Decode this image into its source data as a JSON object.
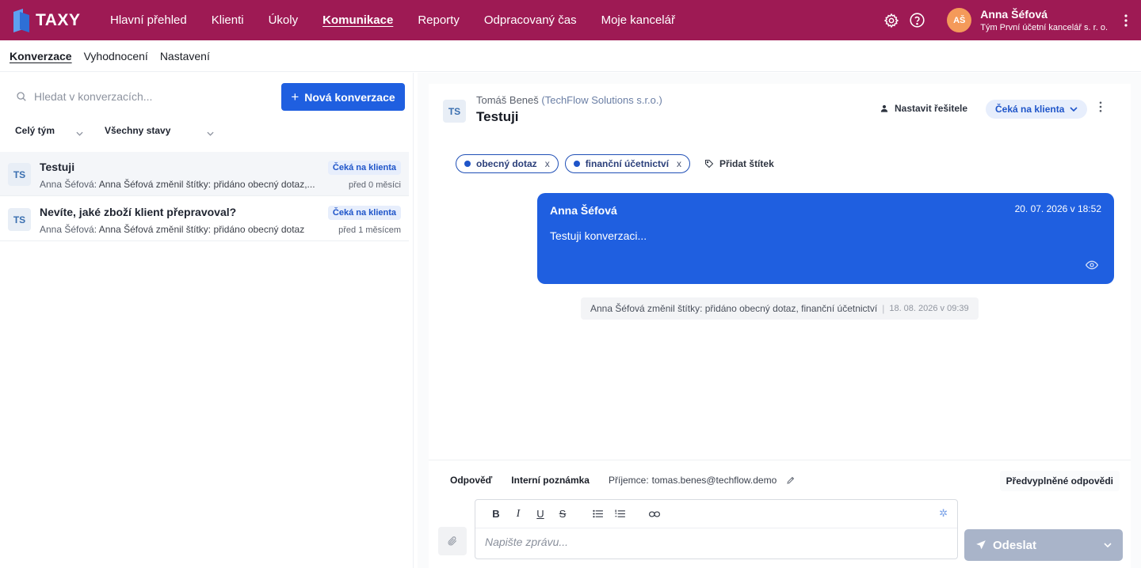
{
  "app": {
    "logo": "TAXY"
  },
  "nav": [
    {
      "label": "Hlavní přehled"
    },
    {
      "label": "Klienti"
    },
    {
      "label": "Úkoly"
    },
    {
      "label": "Komunikace"
    },
    {
      "label": "Reporty"
    },
    {
      "label": "Odpracovaný čas"
    },
    {
      "label": "Moje kancelář"
    }
  ],
  "user": {
    "initials": "AŠ",
    "name": "Anna Šéfová",
    "team": "Tým První účetní kancelář s. r. o."
  },
  "subnav": [
    {
      "label": "Konverzace"
    },
    {
      "label": "Vyhodnocení"
    },
    {
      "label": "Nastavení"
    }
  ],
  "left": {
    "search_placeholder": "Hledat v konverzacích...",
    "new_button": "Nová konverzace",
    "filter_team": "Celý tým",
    "filter_status": "Všechny stavy",
    "conversations": [
      {
        "initials": "TS",
        "title": "Testuji",
        "author": "Anna Šéfová:",
        "preview": "Anna Šéfová změnil štítky: přidáno obecný dotaz,...",
        "badge": "Čeká na klienta",
        "time": "před 0 měsíci"
      },
      {
        "initials": "TS",
        "title": "Nevíte, jaké zboží klient přepravoval?",
        "author": "Anna Šéfová:",
        "preview": "Anna Šéfová změnil štítky: přidáno obecný dotaz",
        "badge": "Čeká na klienta",
        "time": "před 1 měsícem"
      }
    ]
  },
  "detail": {
    "initials": "TS",
    "client_name": "Tomáš Beneš",
    "client_company": "(TechFlow Solutions s.r.o.)",
    "title": "Testuji",
    "assign_label": "Nastavit řešitele",
    "status": "Čeká na klienta",
    "tags": [
      {
        "label": "obecný dotaz",
        "remove": "x"
      },
      {
        "label": "finanční účetnictví",
        "remove": "x"
      }
    ],
    "add_tag": "Přidat štítek",
    "message": {
      "author": "Anna Šéfová",
      "date": "20. 07. 2026 v 18:52",
      "text": "Testuji konverzaci..."
    },
    "event": {
      "text": "Anna Šéfová změnil štítky: přidáno obecný dotaz, finanční účetnictví",
      "sep": "|",
      "date": "18. 08. 2026 v 09:39"
    }
  },
  "composer": {
    "tab_reply": "Odpověď",
    "tab_note": "Interní poznámka",
    "recipient_label": "Příjemce:",
    "recipient": "tomas.benes@techflow.demo",
    "predefined": "Předvyplněné odpovědi",
    "placeholder": "Napište zprávu...",
    "send": "Odeslat",
    "toolbar": {
      "bold": "B",
      "italic": "I",
      "underline": "U",
      "strike": "S"
    }
  },
  "colors": {
    "topbar": "#9e1a54",
    "primary": "#1f5fe0",
    "badge_bg": "#e7eefc",
    "send_disabled": "#a9b4c9"
  }
}
